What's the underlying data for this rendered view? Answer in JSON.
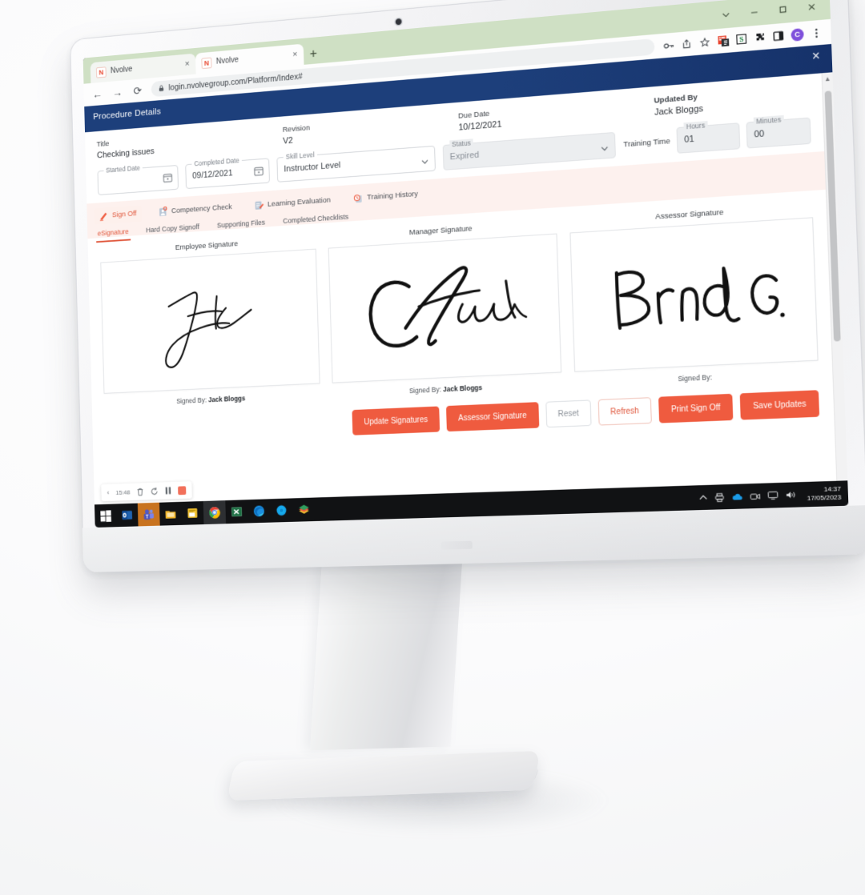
{
  "browser": {
    "tabs": [
      {
        "title": "Nvolve",
        "favicon": "nvolve-favicon",
        "active": false
      },
      {
        "title": "Nvolve",
        "favicon": "nvolve-favicon",
        "active": true
      }
    ],
    "new_tab_label": "+",
    "nav": {
      "back": "←",
      "forward": "→",
      "reload": "⟳"
    },
    "address": {
      "lock": "🔒",
      "url": "login.nvolvegroup.com/Platform/Index#"
    },
    "toolbar_icons": [
      "key-icon",
      "share-icon",
      "star-icon",
      "grammarly-extension-icon",
      "s-extension-icon",
      "puzzle-extension-icon",
      "sidepanel-icon"
    ],
    "profile_initial": "C",
    "menu_icon": "three-dot-menu-icon",
    "window_controls": [
      "chevron-down-icon",
      "minimize-icon",
      "maximize-icon",
      "close-icon"
    ]
  },
  "app": {
    "header_title": "Procedure Details",
    "close_label": "×",
    "fields": {
      "title_label": "Title",
      "title_value": "Checking issues",
      "revision_label": "Revision",
      "revision_value": "V2",
      "due_date_label": "Due Date",
      "due_date_value": "10/12/2021",
      "updated_by_label": "Updated By",
      "updated_by_value": "Jack Bloggs",
      "started_date_label": "Started Date",
      "started_date_value": "",
      "completed_date_label": "Completed Date",
      "completed_date_value": "09/12/2021",
      "skill_level_label": "Skill Level",
      "skill_level_value": "Instructor Level",
      "status_label": "Status",
      "status_value": "Expired",
      "training_time_label": "Training Time",
      "hours_label": "Hours",
      "hours_value": "01",
      "minutes_label": "Minutes",
      "minutes_value": "00"
    },
    "main_tabs": [
      {
        "label": "Sign Off",
        "icon": "pen-signature-icon",
        "active": true
      },
      {
        "label": "Competency Check",
        "icon": "clipboard-person-icon",
        "active": false
      },
      {
        "label": "Learning Evaluation",
        "icon": "clipboard-pencil-icon",
        "active": false
      },
      {
        "label": "Training History",
        "icon": "clock-history-icon",
        "active": false
      }
    ],
    "sub_tabs": [
      {
        "label": "eSignature",
        "active": true
      },
      {
        "label": "Hard Copy Signoff",
        "active": false
      },
      {
        "label": "Supporting Files",
        "active": false
      },
      {
        "label": "Completed Checklists",
        "active": false
      }
    ],
    "signatures": [
      {
        "title": "Employee Signature",
        "signature_text": "Jack",
        "signed_by_label": "Signed By:",
        "signed_by_value": "Jack Bloggs"
      },
      {
        "title": "Manager Signature",
        "signature_text": "C Farrell",
        "signed_by_label": "Signed By:",
        "signed_by_value": "Jack Bloggs"
      },
      {
        "title": "Assessor Signature",
        "signature_text": "Brenda G.",
        "signed_by_label": "Signed By:",
        "signed_by_value": ""
      }
    ],
    "buttons": [
      {
        "label": "Update Signatures",
        "style": "primary"
      },
      {
        "label": "Assessor Signature",
        "style": "primary"
      },
      {
        "label": "Reset",
        "style": "ghost"
      },
      {
        "label": "Refresh",
        "style": "ghost-red"
      },
      {
        "label": "Print Sign Off",
        "style": "primary"
      },
      {
        "label": "Save Updates",
        "style": "primary"
      }
    ],
    "accent_color": "#ef5b3f",
    "header_color": "#1d3f7b"
  },
  "recorder": {
    "back_icon": "chevron-left-icon",
    "elapsed": "15:48",
    "delete_icon": "trash-icon",
    "restart_icon": "restart-icon",
    "pause_icon": "pause-icon",
    "stop_icon": "stop-icon"
  },
  "taskbar": {
    "start_icon": "windows-start-icon",
    "apps": [
      "outlook-icon",
      "teams-icon",
      "file-explorer-icon",
      "notes-icon",
      "chrome-icon",
      "excel-icon",
      "edge-icon",
      "cortana-icon",
      "books-icon"
    ],
    "tray_icons": [
      "show-hidden-icons-chevron",
      "printer-icon",
      "onedrive-icon",
      "camera-icon",
      "display-icon",
      "volume-icon"
    ],
    "time": "14:37",
    "date": "17/05/2023"
  }
}
